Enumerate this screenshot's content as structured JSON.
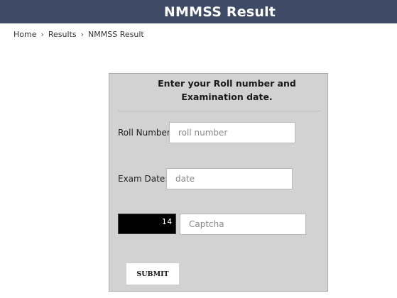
{
  "header": {
    "title": "NMMSS Result"
  },
  "breadcrumb": {
    "items": [
      "Home",
      "Results",
      "NMMSS Result"
    ],
    "separator": "›"
  },
  "form": {
    "title": "Enter your Roll number and Examination date.",
    "roll": {
      "label": "Roll Number:",
      "placeholder": "roll number"
    },
    "date": {
      "label": "Exam Date:",
      "placeholder": "date"
    },
    "captcha": {
      "image_text": "14",
      "placeholder": "Captcha"
    },
    "submit_label": "SUBMIT"
  },
  "colors": {
    "header_bg": "#3f4a66",
    "panel_bg": "#d2d2d2",
    "captcha_bg": "#000000"
  }
}
